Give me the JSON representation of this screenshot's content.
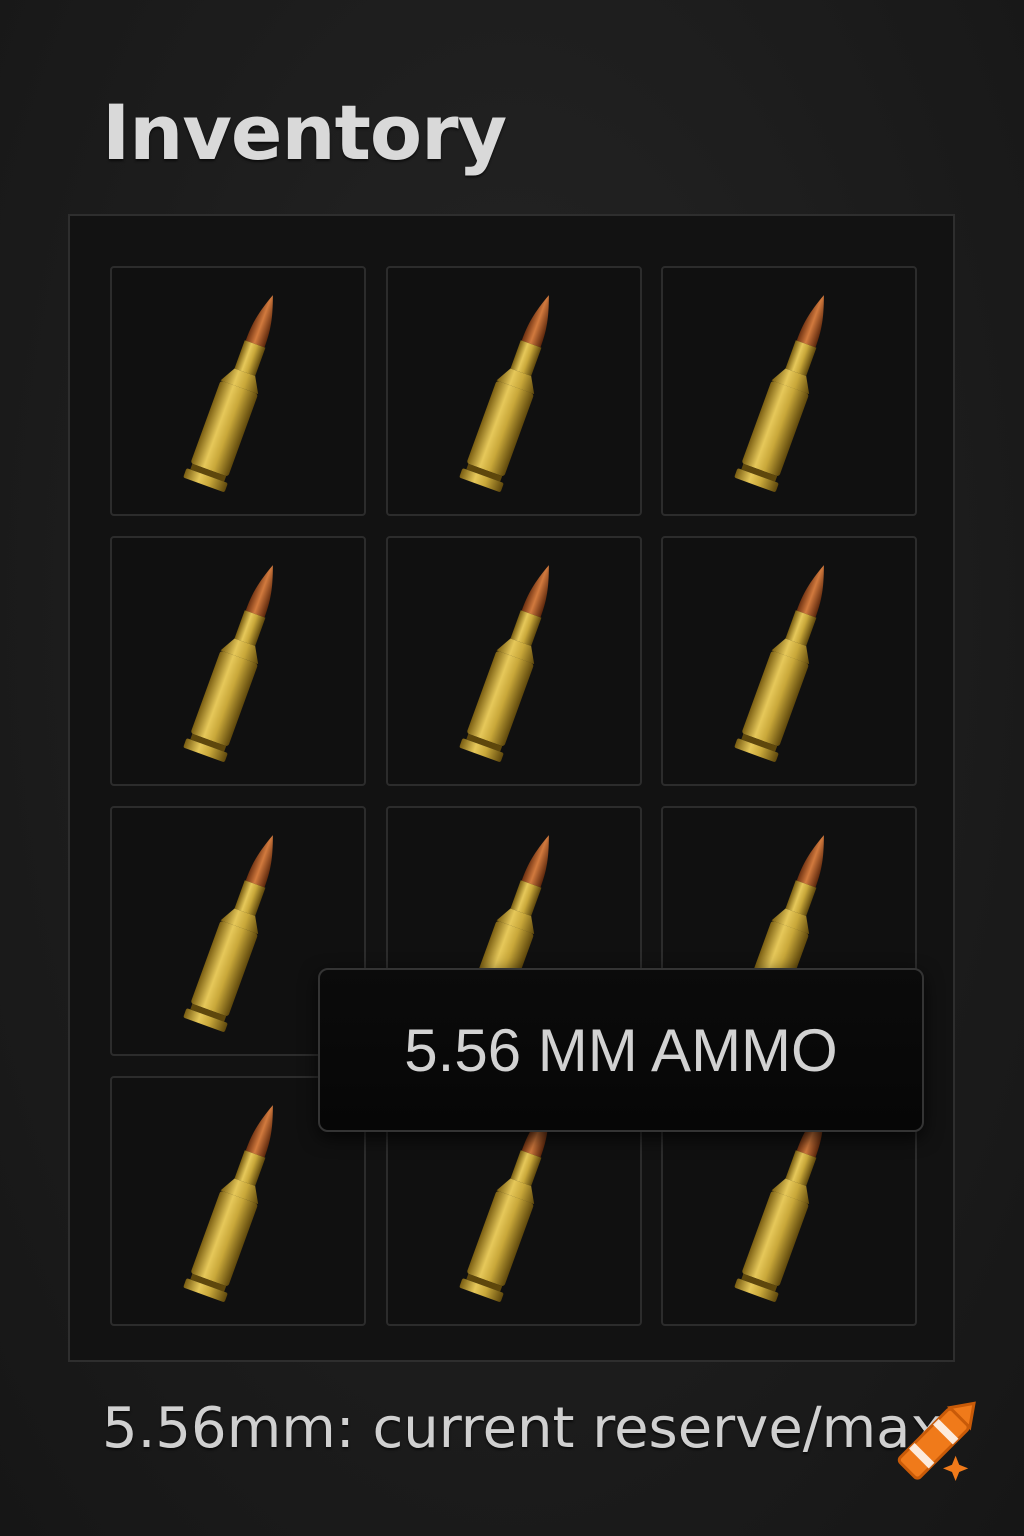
{
  "header": {
    "title": "Inventory"
  },
  "inventory": {
    "slots": [
      {
        "item": "5.56 MM AMMO",
        "icon": "bullet-icon"
      },
      {
        "item": "5.56 MM AMMO",
        "icon": "bullet-icon"
      },
      {
        "item": "5.56 MM AMMO",
        "icon": "bullet-icon"
      },
      {
        "item": "5.56 MM AMMO",
        "icon": "bullet-icon"
      },
      {
        "item": "5.56 MM AMMO",
        "icon": "bullet-icon"
      },
      {
        "item": "5.56 MM AMMO",
        "icon": "bullet-icon"
      },
      {
        "item": "5.56 MM AMMO",
        "icon": "bullet-icon"
      },
      {
        "item": "5.56 MM AMMO",
        "icon": "bullet-icon"
      },
      {
        "item": "5.56 MM AMMO",
        "icon": "bullet-icon"
      },
      {
        "item": "5.56 MM AMMO",
        "icon": "bullet-icon"
      },
      {
        "item": "5.56 MM AMMO",
        "icon": "bullet-icon"
      },
      {
        "item": "5.56 MM AMMO",
        "icon": "bullet-icon"
      }
    ]
  },
  "tooltip": {
    "label": "5.56 MM AMMO"
  },
  "footer": {
    "text": "5.56mm: current reserve/max"
  },
  "colors": {
    "background": "#1c1c1c",
    "panel": "#121212",
    "slot_border": "#2c2c2c",
    "brass": "#c9a83a",
    "copper": "#b5602a",
    "badge": "#f07a1a"
  }
}
